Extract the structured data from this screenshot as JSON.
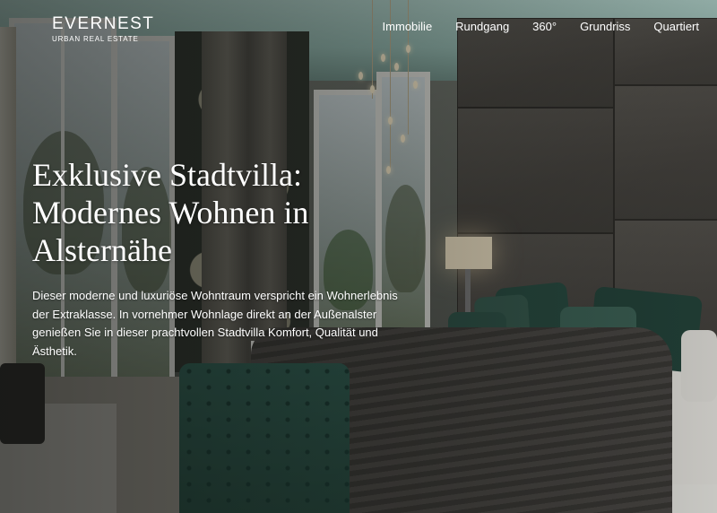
{
  "brand": {
    "name": "EVERNEST",
    "tagline": "URBAN REAL ESTATE"
  },
  "nav": {
    "items": [
      {
        "label": "Immobilie"
      },
      {
        "label": "Rundgang"
      },
      {
        "label": "360°"
      },
      {
        "label": "Grundriss"
      },
      {
        "label": "Quartiert"
      }
    ]
  },
  "hero": {
    "headline_lines": [
      "Exklusive Stadtvilla:",
      "Modernes Wohnen in",
      "Alsternähe"
    ],
    "intro": "Dieser moderne und luxuriöse Wohntraum verspricht ein Wohnerlebnis der Extraklasse. In vornehmer Wohnlage direkt an der Außenalster genießen Sie in dieser prachtvollen Stadtvilla Komfort, Qualität und Ästhetik.",
    "image_subject": "bedroom-interior-photo"
  },
  "colors": {
    "text": "#ffffff",
    "ceiling": "#9fbfb8",
    "velvet_green": "#2f5b50",
    "headboard": "#4a4743"
  }
}
